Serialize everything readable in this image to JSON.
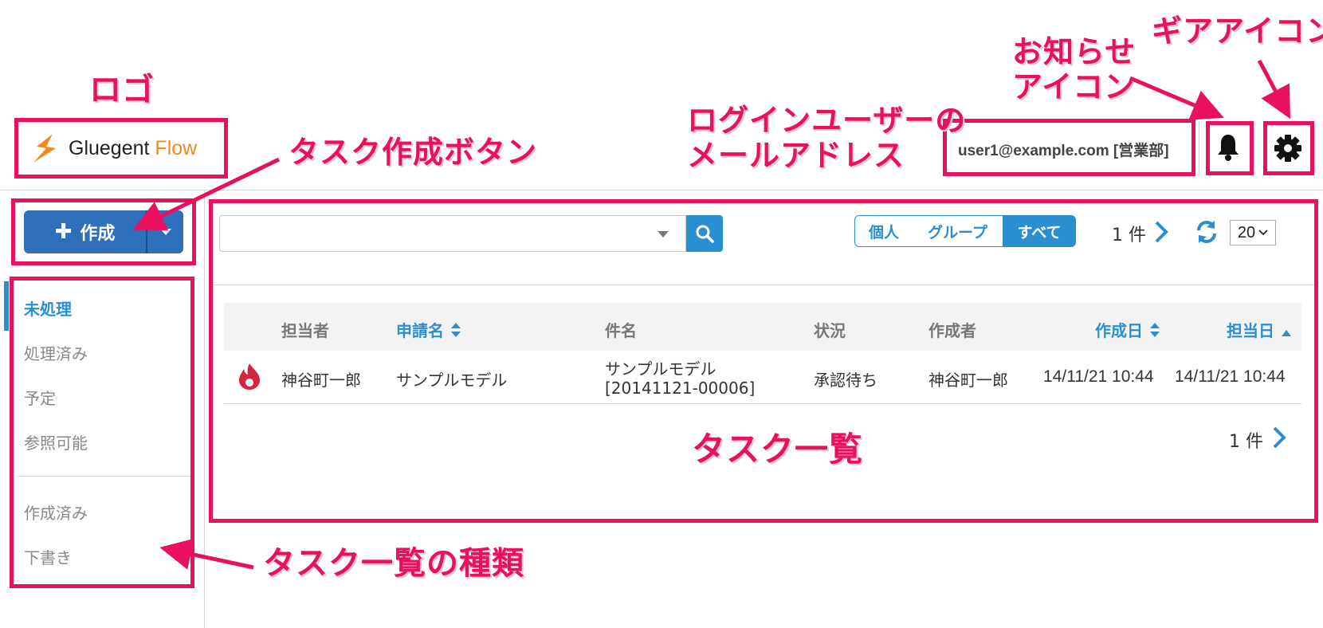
{
  "header": {
    "logo": {
      "main": "Gluegent ",
      "accent": "Flow"
    },
    "user_email": "user1@example.com [営業部]",
    "bell_icon": "bell-icon",
    "gear_icon": "gear-icon"
  },
  "toolbar": {
    "create_label": "作成",
    "search_placeholder": "",
    "segments": [
      "個人",
      "グループ",
      "すべて"
    ],
    "selected_segment": "すべて",
    "count_label": "1 件",
    "page_size": "20"
  },
  "sidebar": {
    "items": [
      {
        "label": "未処理",
        "active": true
      },
      {
        "label": "処理済み"
      },
      {
        "label": "予定"
      },
      {
        "label": "参照可能"
      },
      {
        "label": "作成済み"
      },
      {
        "label": "下書き"
      }
    ]
  },
  "table": {
    "columns": [
      "担当者",
      "申請名",
      "件名",
      "状況",
      "作成者",
      "作成日",
      "担当日"
    ],
    "rows": [
      {
        "assignee": "神谷町一郎",
        "application": "サンプルモデル",
        "subject_line1": "サンプルモデル",
        "subject_line2": "[20141121-00006]",
        "status": "承認待ち",
        "creator": "神谷町一郎",
        "created": "14/11/21 10:44",
        "assigned": "14/11/21 10:44"
      }
    ],
    "footer_count": "1 件"
  },
  "annotations": {
    "logo": "ロゴ",
    "notification_line1": "お知らせ",
    "notification_line2": "アイコン",
    "gear": "ギアアイコン",
    "user_line1": "ログインユーザーの",
    "user_line2": "メールアドレス",
    "create_button": "タスク作成ボタン",
    "task_list": "タスク一覧",
    "list_types": "タスク一覧の種類"
  },
  "colors": {
    "accent": "#2a8fd0",
    "create_button": "#2d6fb8",
    "annotation": "#e8105f",
    "logo_orange": "#f08a1c"
  }
}
